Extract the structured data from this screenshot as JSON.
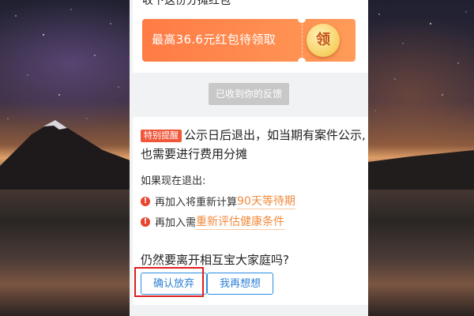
{
  "background": {
    "type": "night sky wallpaper with mountain lake"
  },
  "top_card": {
    "title": "收下这份分摊红包",
    "coupon_text": "最高36.6元红包待领取",
    "claim_label": "领"
  },
  "feedback_label": "已收到你的反馈",
  "notice": {
    "tag": "特别提醒",
    "headline_line1": "公示日后退出，如当期有案件公示,",
    "headline_line2": "也需要进行费用分摊",
    "subheading": "如果现在退出:",
    "items": [
      {
        "prefix": "再加入将重新计算",
        "highlight": "90天等待期"
      },
      {
        "prefix": "再加入需",
        "highlight": "重新评估健康条件"
      }
    ],
    "question": "仍然要离开相互宝大家庭吗?"
  },
  "buttons": {
    "confirm_label": "确认放弃",
    "reconsider_label": "我再想想"
  },
  "colors": {
    "coupon_orange": "#ff8a4c",
    "tag_red": "#f0573a",
    "highlight_orange": "#f08a3c",
    "button_blue": "#2c8ee0",
    "annotation_red": "#e01e1e"
  }
}
